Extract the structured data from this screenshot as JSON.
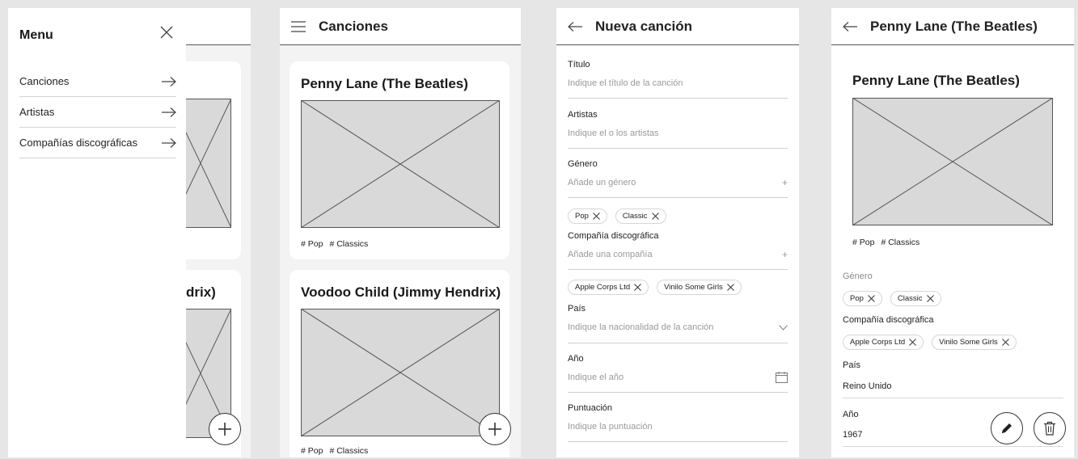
{
  "menu_screen": {
    "title": "Menu",
    "items": [
      {
        "label": "Canciones"
      },
      {
        "label": "Artistas"
      },
      {
        "label": "Compañías discográficas"
      }
    ],
    "behind_title_fragment": "drix)"
  },
  "list_screen": {
    "title": "Canciones",
    "cards": [
      {
        "title": "Penny Lane (The Beatles)",
        "tags": [
          "# Pop",
          "# Classics"
        ]
      },
      {
        "title": "Voodoo Child (Jimmy Hendrix)",
        "tags": [
          "# Pop",
          "# Classics"
        ]
      }
    ]
  },
  "form_screen": {
    "title": "Nueva canción",
    "fields": {
      "titulo": {
        "label": "Título",
        "placeholder": "Indique el título de la canción"
      },
      "artistas": {
        "label": "Artistas",
        "placeholder": "Indique el o los artistas"
      },
      "genero": {
        "label": "Género",
        "placeholder": "Añade un género"
      },
      "compania": {
        "label": "Compañía discográfica",
        "placeholder": "Añade una compañía"
      },
      "pais": {
        "label": "País",
        "placeholder": "Indique la nacionalidad de la canción"
      },
      "anio": {
        "label": "Año",
        "placeholder": "Indique el año"
      },
      "puntuacion": {
        "label": "Puntuación",
        "placeholder": "Indique la puntuación"
      }
    },
    "genre_chips": [
      "Pop",
      "Classic"
    ],
    "company_chips": [
      "Apple Corps Ltd",
      "Vinilo Some Girls"
    ]
  },
  "detail_screen": {
    "title": "Penny Lane (The Beatles)",
    "card_title": "Penny Lane (The Beatles)",
    "tags": [
      "# Pop",
      "# Classics"
    ],
    "genero_label": "Género",
    "genre_chips": [
      "Pop",
      "Classic"
    ],
    "compania_label": "Compañía discográfica",
    "company_chips": [
      "Apple Corps Ltd",
      "Vinilo Some Girls"
    ],
    "pais_label": "País",
    "pais_value": "Reino Unido",
    "anio_label": "Año",
    "anio_value": "1967"
  },
  "colors": {
    "background": "#e6e6e6",
    "placeholder_fill": "#d9d9d9",
    "stroke": "#555555"
  }
}
